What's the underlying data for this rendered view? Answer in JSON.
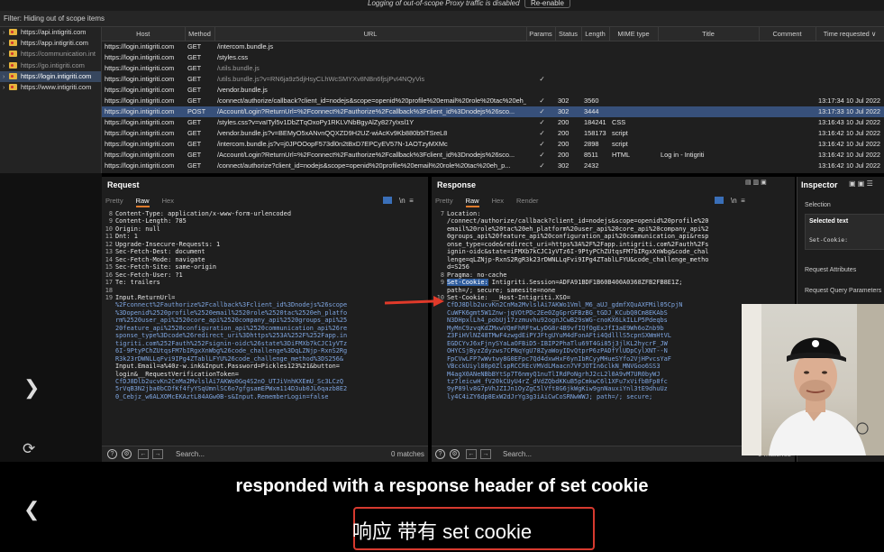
{
  "top_message": "Logging of out-of-scope Proxy traffic is disabled",
  "top_button": "Re-enable",
  "filter_text": "Filter: Hiding out of scope items",
  "site_tree": [
    {
      "label": "https://api.intigriti.com",
      "gray": false,
      "selected": false
    },
    {
      "label": "https://app.intigriti.com",
      "gray": false,
      "selected": false
    },
    {
      "label": "https://communication.int",
      "gray": true,
      "selected": false
    },
    {
      "label": "https://go.intigriti.com",
      "gray": true,
      "selected": false
    },
    {
      "label": "https://login.intigriti.com",
      "gray": false,
      "selected": true
    },
    {
      "label": "https://www.intigriti.com",
      "gray": false,
      "selected": false
    }
  ],
  "history_columns": [
    "Host",
    "Method",
    "URL",
    "Params",
    "Status",
    "Length",
    "MIME type",
    "Title",
    "Comment",
    "Time requested ∨"
  ],
  "history_rows": [
    {
      "host": "https://login.intigriti.com",
      "method": "GET",
      "url": "/intercom.bundle.js",
      "params": "",
      "status": "",
      "length": "",
      "mime": "",
      "title": "",
      "time": "",
      "sel": false,
      "gray": false
    },
    {
      "host": "https://login.intigriti.com",
      "method": "GET",
      "url": "/styles.css",
      "params": "",
      "status": "",
      "length": "",
      "mime": "",
      "title": "",
      "time": "",
      "sel": false,
      "gray": false
    },
    {
      "host": "https://login.intigriti.com",
      "method": "GET",
      "url": "/utils.bundle.js",
      "params": "",
      "status": "",
      "length": "",
      "mime": "",
      "title": "",
      "time": "",
      "sel": false,
      "gray": true
    },
    {
      "host": "https://login.intigriti.com",
      "method": "GET",
      "url": "/utils.bundle.js?v=RN6ja9z5djHsyCLhWcSMYXv8NBn6fjsjPvI4NQyVis",
      "params": "✓",
      "status": "",
      "length": "",
      "mime": "",
      "title": "",
      "time": "",
      "sel": false,
      "gray": true
    },
    {
      "host": "https://login.intigriti.com",
      "method": "GET",
      "url": "/vendor.bundle.js",
      "params": "",
      "status": "",
      "length": "",
      "mime": "",
      "title": "",
      "time": "",
      "sel": false,
      "gray": false
    },
    {
      "host": "https://login.intigriti.com",
      "method": "GET",
      "url": "/connect/authorize/callback?client_id=nodejs&scope=openid%20profile%20email%20role%20tac%20eh_platfo...",
      "params": "✓",
      "status": "302",
      "length": "3560",
      "mime": "",
      "title": "",
      "time": "13:17:34 10 Jul 2022",
      "sel": false,
      "gray": false
    },
    {
      "host": "https://login.intigriti.com",
      "method": "POST",
      "url": "/Account/Login?ReturnUrl=%2Fconnect%2Fauthorize%2Fcallback%3Fclient_id%3Dnodejs%26sco...",
      "params": "✓",
      "status": "302",
      "length": "3444",
      "mime": "",
      "title": "",
      "time": "13:17:33 10 Jul 2022",
      "sel": true,
      "gray": false
    },
    {
      "host": "https://login.intigriti.com",
      "method": "GET",
      "url": "/styles.css?v=vaITyl5v1DbZTqOxoPy1RKLVNbBgyAlZy827yIxsl1Y",
      "params": "✓",
      "status": "200",
      "length": "184241",
      "mime": "CSS",
      "title": "",
      "time": "13:16:43 10 Jul 2022",
      "sel": false,
      "gray": false
    },
    {
      "host": "https://login.intigriti.com",
      "method": "GET",
      "url": "/vendor.bundle.js?v=BEMyO5xANvnQQXZD9H2UZ-wiAcKv9Kb880b5iTSreL8",
      "params": "✓",
      "status": "200",
      "length": "158173",
      "mime": "script",
      "title": "",
      "time": "13:16:42 10 Jul 2022",
      "sel": false,
      "gray": false
    },
    {
      "host": "https://login.intigriti.com",
      "method": "GET",
      "url": "/intercom.bundle.js?v=j0JPOOopF573dl0n2tBxD7EPCyEV57N-1AOTzyMXMc",
      "params": "✓",
      "status": "200",
      "length": "2898",
      "mime": "script",
      "title": "",
      "time": "13:16:42 10 Jul 2022",
      "sel": false,
      "gray": false
    },
    {
      "host": "https://login.intigriti.com",
      "method": "GET",
      "url": "/Account/Login?ReturnUrl=%2Fconnect%2Fauthorize%2Fcallback%3Fclient_id%3Dnodejs%26sco...",
      "params": "✓",
      "status": "200",
      "length": "8511",
      "mime": "HTML",
      "title": "Log in - Intigriti",
      "time": "13:16:42 10 Jul 2022",
      "sel": false,
      "gray": false
    },
    {
      "host": "https://login.intigriti.com",
      "method": "GET",
      "url": "/connect/authorize?client_id=nodejs&scope=openid%20profile%20email%20role%20tac%20eh_p...",
      "params": "✓",
      "status": "302",
      "length": "2432",
      "mime": "",
      "title": "",
      "time": "13:16:42 10 Jul 2022",
      "sel": false,
      "gray": false
    }
  ],
  "request": {
    "title": "Request",
    "tabs": [
      "Pretty",
      "Raw",
      "Hex"
    ],
    "active_tab": "Raw",
    "lines": [
      {
        "n": "8",
        "t": "Content-Type: application/x-www-form-urlencoded"
      },
      {
        "n": "9",
        "t": "Content-Length: 785"
      },
      {
        "n": "10",
        "t": "Origin: null"
      },
      {
        "n": "11",
        "t": "Dnt: 1"
      },
      {
        "n": "12",
        "t": "Upgrade-Insecure-Requests: 1"
      },
      {
        "n": "13",
        "t": "Sec-Fetch-Dest: document"
      },
      {
        "n": "14",
        "t": "Sec-Fetch-Mode: navigate"
      },
      {
        "n": "15",
        "t": "Sec-Fetch-Site: same-origin"
      },
      {
        "n": "16",
        "t": "Sec-Fetch-User: ?1"
      },
      {
        "n": "17",
        "t": "Te: trailers"
      },
      {
        "n": "18",
        "t": ""
      },
      {
        "n": "19",
        "t": "Input.ReturnUrl="
      },
      {
        "n": "",
        "t": "%2Fconnect%2Fauthorize%2Fcallback%3Fclient_id%3Dnodejs%26scope",
        "blue": true
      },
      {
        "n": "",
        "t": "%3Dopenid%2520profile%2520email%2520role%2520tac%2520eh_platfo",
        "blue": true
      },
      {
        "n": "",
        "t": "rm%2520user_api%2520core_api%2520company_api%2520groups_api%25",
        "blue": true
      },
      {
        "n": "",
        "t": "20feature_api%2520configuration_api%2520communication_api%26re",
        "blue": true
      },
      {
        "n": "",
        "t": "sponse_type%3Dcode%26redirect_uri%3Dhttps%253A%252F%252Fapp.in",
        "blue": true
      },
      {
        "n": "",
        "t": "tigriti.com%252Fauth%252Fsignin-oidc%26state%3DiFMXb7kCJC1yVTz",
        "blue": true
      },
      {
        "n": "",
        "t": "6I-9PtyPChZUtqsFM7bIRgxXnWbg%26code_challenge%3DqLZNjp-RxnS2Rg",
        "blue": true
      },
      {
        "n": "",
        "t": "R3k23rDWNLLqFvi9IPg4ZTablLFYU%26code_challenge_method%3DS256&",
        "blue": true
      },
      {
        "n": "",
        "t": "Input.Email=a%40z-w.ink&Input.Password=Pickles123%21&button="
      },
      {
        "n": "",
        "t": "login&__RequestVerificationToken="
      },
      {
        "n": "",
        "t": "CfDJ8Dlb2ucvKn2CnMa2MvlslAi7AKWo0Gq4S2nO_UTJiVnhKXEmU_Sc3LCzQ",
        "blue": true
      },
      {
        "n": "",
        "t": "5rVqB3N2jba0bCDfKf4fyYSqUmnlSC6o7gfgsamEPWxm114D3ub0JL6qazb8E2",
        "blue": true
      },
      {
        "n": "",
        "t": "0_Cebjz_w6ALXOMcEKAztL84AGw0B-s&Input.RememberLogin=false",
        "blue": true
      }
    ],
    "search_placeholder": "Search...",
    "matches": "0 matches"
  },
  "response": {
    "title": "Response",
    "tabs": [
      "Pretty",
      "Raw",
      "Hex",
      "Render"
    ],
    "active_tab": "Raw",
    "lines": [
      {
        "n": "7",
        "t": "Location:"
      },
      {
        "n": "",
        "t": "/connect/authorize/callback?client_id=nodejs&scope=openid%20profile%20"
      },
      {
        "n": "",
        "t": "email%20role%20tac%20eh_platform%20user_api%20core_api%20company_api%2"
      },
      {
        "n": "",
        "t": "0groups_api%20feature_api%20configuration_api%20communication_api&resp"
      },
      {
        "n": "",
        "t": "onse_type=code&redirect_uri=https%3A%2F%2Fapp.intigriti.com%2Fauth%2Fs"
      },
      {
        "n": "",
        "t": "ignin-oidc&state=iFMXb7kCJC1yVTz6I-9PtyPChZUtqsFM7bIRgxXnWbg&code_chal"
      },
      {
        "n": "",
        "t": "lenge=qLZNjp-RxnS2RgR3k23rDWNLLqFvi9IPg4ZTablLFYU&code_challenge_metho"
      },
      {
        "n": "",
        "t": "d=S256"
      },
      {
        "n": "8",
        "t": "Pragma: no-cache"
      },
      {
        "n": "9",
        "hl": "Set-Cookie:",
        "t": " Intigriti.Session=ADFA91BDF1B60B400A0368ZFB2FB8E1Z;"
      },
      {
        "n": "",
        "t": "path=/; secure; samesite=none"
      },
      {
        "n": "10",
        "t": "Set-Cookie: __Host-Intigriti.XSO="
      },
      {
        "n": "",
        "t": "CfDJ8Dlb2ucvKn2CnMa2MvlslAi7AKWo1Vml_M6_aUJ_gdmfXQuAXFMil05CpjN",
        "blue": true
      },
      {
        "n": "",
        "t": "CuWFK6gmt5W1Znw-jqVOtPDc2Ee0ZgGprGFBzBG_tGDJ_KCubQ0Cm8EKAbS",
        "blue": true
      },
      {
        "n": "",
        "t": "N3DHpxlLh4_pobUj17zzmuvhu92ognJCwB29sWG-cnoKX6LkILLP5Pdeqbs",
        "blue": true
      },
      {
        "n": "",
        "t": "MyMnC9zvqKdZMxwVQmFhRFtwLyDG8r4B9vfIQfOgExJfI3aE9Wh6oZnb9b",
        "blue": true
      },
      {
        "n": "",
        "t": "Z3FiHVlNZ48TMwF4zwgdEiPYJFtgUYuM4dFonAFti4QdlllS5cpnSXWmHtVL",
        "blue": true
      },
      {
        "n": "",
        "t": "EGDCYvJ6xFjnySYaLaOFBiD5-IBIP2PhaTlu69T4Gi85j3jlKL2hycrF_JW",
        "blue": true
      },
      {
        "n": "",
        "t": "OHYCSjByzZdyzws7CPNqYgU78ZyaWoyIDvQtprP6zPADfYlUDpCylXNT--N",
        "blue": true
      },
      {
        "n": "",
        "t": "FpCVwLFP7wWvtwy8G0EFpc7Qd4dxwHxF6ynIbRCyyMHueSYfo2VjHPvcsYaF",
        "blue": true
      },
      {
        "n": "",
        "t": "VBcckUiyl80p0ZlspRCCREcVMVdLMaacn7VFJOTIn6clkN_MNVGoo6SS3",
        "blue": true
      },
      {
        "n": "",
        "t": "M4agX0ANeNBbBYtSp7T6nmyQ1nuTlIRdPoNgrhJ2cL2l0A9vM7UR0byWJ",
        "blue": true
      },
      {
        "n": "",
        "t": "tz7leicwH_fV20kCUyU4rZ_dVdZQbdKKuB5pCmkwC6l1XFu7xVifbBFp8fc",
        "blue": true
      },
      {
        "n": "",
        "t": "9yP89lv8G7pVhJZIJn1OyZgC5lVft8G6jkWgKiw9gnNauxiYnl3tE9dhuUz",
        "blue": true
      },
      {
        "n": "",
        "t": "ly4C4iZY6dp8ExW2dJrYg3g3iAiCwCoSRNwWWJ; path=/; secure;",
        "blue": true
      }
    ],
    "search_placeholder": "Search...",
    "matches": "0 matches"
  },
  "inspector": {
    "title": "Inspector",
    "selection_label": "Selection",
    "selected_text_label": "Selected text",
    "selected_text_value": "Set-Cookie:",
    "request_attributes": "Request Attributes",
    "request_query_params": "Request Query Parameters"
  },
  "subtitles": {
    "english": "responded with a response header of set cookie",
    "chinese": "响应 带有 set cookie"
  }
}
